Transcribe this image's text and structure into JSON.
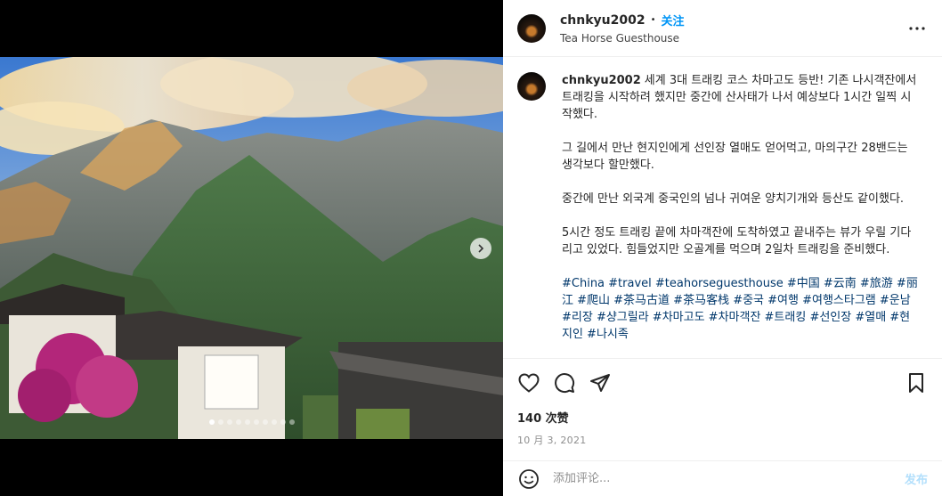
{
  "post": {
    "username": "chnkyu2002",
    "separator": "•",
    "follow_label": "关注",
    "location": "Tea Horse Guesthouse",
    "more_icon": "more-horizontal-icon"
  },
  "caption": {
    "username": "chnkyu2002",
    "paragraphs": [
      "세계 3대 트래킹 코스 차마고도 등반! 기존 나시객잔에서 트래킹을 시작하려 했지만 중간에 산사태가 나서 예상보다 1시간 일찍 시작했다.",
      "그 길에서 만난 현지인에게 선인장 열매도 얻어먹고, 마의구간 28밴드는 생각보다 할만했다.",
      "중간에 만난 외국계 중국인의 넘나 귀여운 양치기개와 등산도 같이했다.",
      "5시간 정도 트래킹 끝에 차마객잔에 도착하였고 끝내주는 뷰가 우릴 기다리고 있었다. 힘들었지만 오골계를 먹으며 2일차 트래킹을 준비했다."
    ],
    "tags": "#China #travel #teahorseguesthouse #中国 #云南 #旅游 #丽江 #爬山 #茶马古道 #茶马客栈 #중국 #여행 #여행스타그램 #운남 #리장 #샹그릴라 #차마고도 #차마객잔 #트래킹 #선인장 #열매 #현지인 #나시족"
  },
  "stats": {
    "likes": "140 次赞",
    "date": "10 月 3, 2021"
  },
  "comment": {
    "placeholder": "添加评论...",
    "post_label": "发布"
  },
  "carousel": {
    "total": 10,
    "active_index": 0
  },
  "colors": {
    "accent": "#0095f6",
    "link": "#00376b",
    "post_disabled": "#b2dffc"
  }
}
